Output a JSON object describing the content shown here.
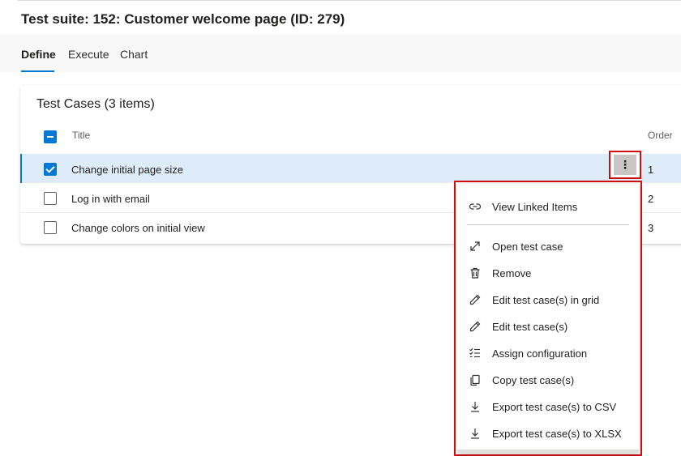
{
  "suite": {
    "title": "Test suite: 152: Customer welcome page (ID: 279)"
  },
  "tabs": [
    {
      "label": "Define",
      "active": true
    },
    {
      "label": "Execute",
      "active": false
    },
    {
      "label": "Chart",
      "active": false
    }
  ],
  "test_cases": {
    "heading": "Test Cases (3 items)",
    "columns": {
      "title": "Title",
      "order": "Order"
    },
    "rows": [
      {
        "title": "Change initial page size",
        "order": "1",
        "checked": true
      },
      {
        "title": "Log in with email",
        "order": "2",
        "checked": false
      },
      {
        "title": "Change colors on initial view",
        "order": "3",
        "checked": false
      }
    ],
    "more_glyph": "⋮"
  },
  "context_menu": {
    "items": [
      {
        "label": "View Linked Items",
        "icon": "link-icon"
      },
      {
        "label": "Open test case",
        "icon": "open-expand-icon"
      },
      {
        "label": "Remove",
        "icon": "trash-icon"
      },
      {
        "label": "Edit test case(s) in grid",
        "icon": "pencil-icon"
      },
      {
        "label": "Edit test case(s)",
        "icon": "pencil-icon"
      },
      {
        "label": "Assign configuration",
        "icon": "checklist-icon"
      },
      {
        "label": "Copy test case(s)",
        "icon": "copy-icon"
      },
      {
        "label": "Export test case(s) to CSV",
        "icon": "download-icon"
      },
      {
        "label": "Export test case(s) to XLSX",
        "icon": "download-icon"
      }
    ]
  },
  "colors": {
    "accent": "#0078d4",
    "highlight_border": "#d20f0f",
    "selected_row": "#deecf9"
  }
}
